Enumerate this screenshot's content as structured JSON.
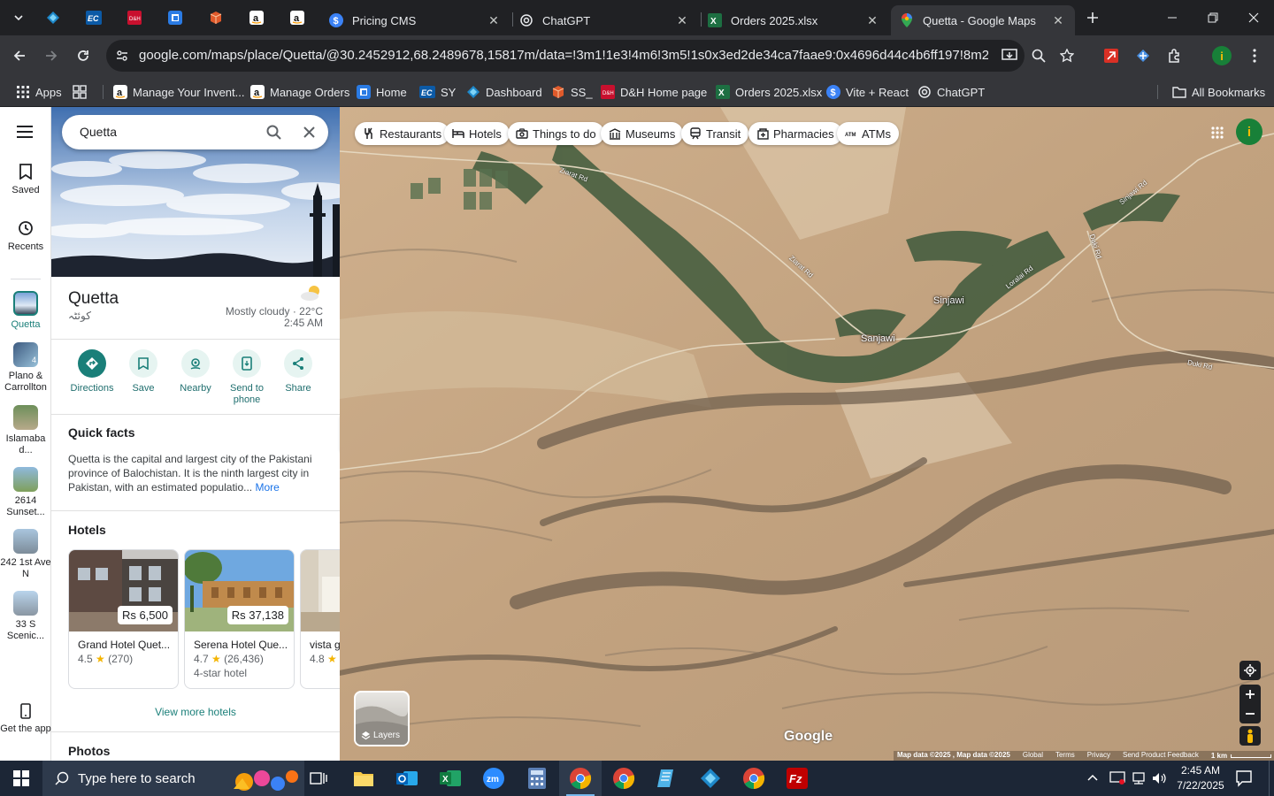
{
  "browser": {
    "pinned_tabs": [
      "blue-diamond-icon",
      "ec-logo-icon",
      "dh-logo-icon",
      "g-logo-icon",
      "package-icon",
      "amazon-icon",
      "amazon-icon"
    ],
    "tabs": [
      {
        "title": "Pricing CMS",
        "icon": "dollar-icon"
      },
      {
        "title": "ChatGPT",
        "icon": "openai-icon"
      },
      {
        "title": "Orders 2025.xlsx",
        "icon": "excel-icon"
      },
      {
        "title": "Quetta - Google Maps",
        "icon": "maps-pin-icon",
        "active": true
      }
    ],
    "url": "google.com/maps/place/Quetta/@30.2452912,68.2489678,15817m/data=!3m1!1e3!4m6!3m5!1s0x3ed2de34ca7faae9:0x4696d44c4b6ff197!8m2!3d30.183...",
    "bookmarks": [
      {
        "label": "Apps",
        "icon": "apps-grid-icon"
      },
      {
        "label": "",
        "icon": "tab-groups-icon"
      },
      {
        "label": "Manage Your Invent...",
        "icon": "amazon-icon"
      },
      {
        "label": "Manage Orders",
        "icon": "amazon-icon"
      },
      {
        "label": "Home",
        "icon": "g-logo-icon"
      },
      {
        "label": "SY",
        "icon": "ec-logo-icon"
      },
      {
        "label": "Dashboard",
        "icon": "blue-diamond-icon"
      },
      {
        "label": "SS_",
        "icon": "package-icon"
      },
      {
        "label": "D&H Home page",
        "icon": "dh-logo-icon"
      },
      {
        "label": "Orders 2025.xlsx",
        "icon": "excel-icon"
      },
      {
        "label": "Vite + React",
        "icon": "dollar-icon"
      },
      {
        "label": "ChatGPT",
        "icon": "openai-icon"
      }
    ],
    "all_bookmarks_label": "All Bookmarks",
    "profile_initial": "i"
  },
  "rail": {
    "saved": "Saved",
    "recents": "Recents",
    "items": [
      {
        "label": "Quetta"
      },
      {
        "label": "Plano & Carrollton",
        "badge": "4"
      },
      {
        "label": "Islamaba d..."
      },
      {
        "label": "2614 Sunset..."
      },
      {
        "label": "242 1st Ave N"
      },
      {
        "label": "33 S Scenic..."
      }
    ],
    "get_app": "Get the app"
  },
  "panel": {
    "search_value": "Quetta",
    "place_name": "Quetta",
    "place_native": "کوئٹہ",
    "weather": "Mostly cloudy · 22°C",
    "local_time": "2:45 AM",
    "actions": [
      {
        "label": "Directions",
        "icon": "directions-icon"
      },
      {
        "label": "Save",
        "icon": "bookmark-icon"
      },
      {
        "label": "Nearby",
        "icon": "nearby-icon"
      },
      {
        "label": "Send to phone",
        "icon": "send-to-phone-icon"
      },
      {
        "label": "Share",
        "icon": "share-icon"
      }
    ],
    "quick_facts_title": "Quick facts",
    "quick_facts_text": "Quetta is the capital and largest city of the Pakistani province of Balochistan. It is the ninth largest city in Pakistan, with an estimated populatio...",
    "more_label": "More",
    "hotels_title": "Hotels",
    "hotels": [
      {
        "price": "Rs 6,500",
        "name": "Grand Hotel Quet...",
        "rating": "4.5",
        "reviews": "(270)",
        "class": ""
      },
      {
        "price": "Rs 37,138",
        "name": "Serena Hotel Que...",
        "rating": "4.7",
        "reviews": "(26,436)",
        "class": "4-star hotel"
      },
      {
        "price": "",
        "name": "vista g",
        "rating": "4.8",
        "reviews": "",
        "class": ""
      }
    ],
    "view_more_hotels": "View more hotels",
    "photos_title": "Photos"
  },
  "map": {
    "chips": [
      {
        "label": "Restaurants",
        "icon": "fork-knife-icon"
      },
      {
        "label": "Hotels",
        "icon": "bed-icon"
      },
      {
        "label": "Things to do",
        "icon": "camera-icon"
      },
      {
        "label": "Museums",
        "icon": "museum-icon"
      },
      {
        "label": "Transit",
        "icon": "train-icon"
      },
      {
        "label": "Pharmacies",
        "icon": "pharmacy-icon"
      },
      {
        "label": "ATMs",
        "icon": "atm-icon"
      }
    ],
    "places": [
      "Sinjawi",
      "Sanjawi"
    ],
    "roads": [
      "Ziarat Rd",
      "Ziarat Rd",
      "Loralai Rd",
      "Duki Rd",
      "Duki Rd",
      "Sinjawi Rd"
    ],
    "layers_label": "Layers",
    "google_logo": "Google",
    "attribution": [
      "Map data ©2025 , Map data ©2025",
      "Global",
      "Terms",
      "Privacy",
      "Send Product Feedback",
      "1 km"
    ]
  },
  "taskbar": {
    "search_placeholder": "Type here to search",
    "time": "2:45 AM",
    "date": "7/22/2025"
  },
  "colors": {
    "accent_teal": "#1a7f79",
    "link_blue": "#1a73e8",
    "chrome_dark": "#202124",
    "chrome_toolbar": "#35363a"
  }
}
